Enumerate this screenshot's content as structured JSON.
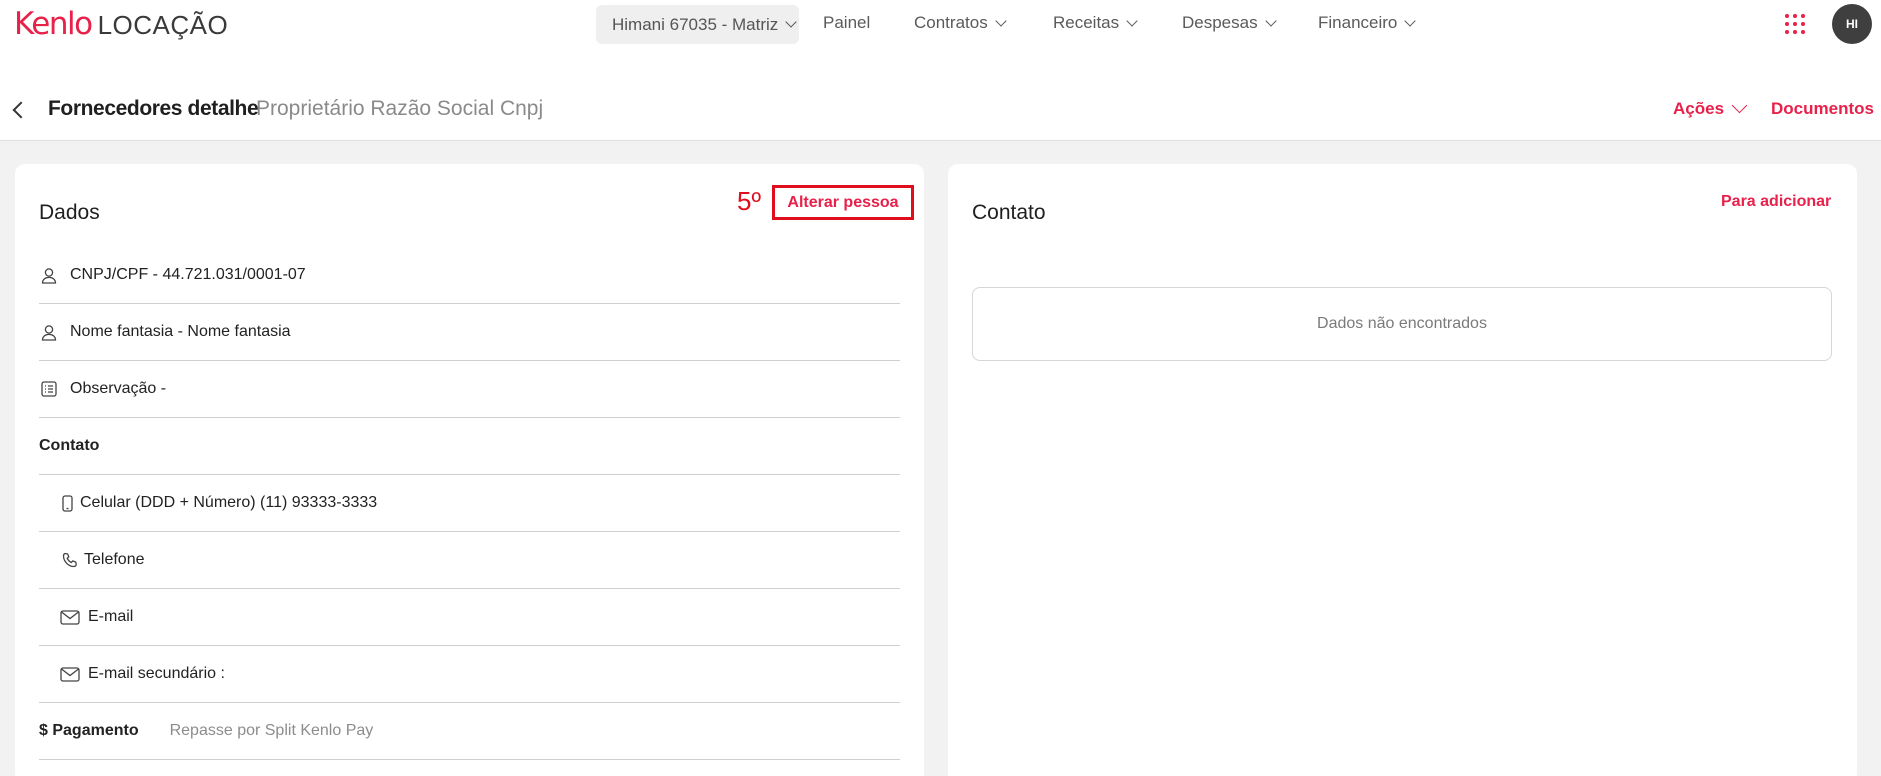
{
  "topbar": {
    "brand": "Kenlo",
    "product": "LOCAÇÃO",
    "selector": "Himani 67035 - Matriz",
    "nav": [
      {
        "label": "Painel"
      },
      {
        "label": "Contratos"
      },
      {
        "label": "Receitas"
      },
      {
        "label": "Despesas"
      },
      {
        "label": "Financeiro"
      }
    ],
    "avatar_initials": "HI",
    "apps_icon": "grid-dots-icon"
  },
  "header": {
    "title": "Fornecedores detalhe",
    "subtitle": "Proprietário Razão Social Cnpj",
    "acoes": "Ações",
    "documentos": "Documentos"
  },
  "dados": {
    "title": "Dados",
    "step_marker": "5º",
    "alterar": "Alterar pessoa",
    "rows": [
      {
        "icon": "user-icon",
        "text": "CNPJ/CPF - 44.721.031/0001-07"
      },
      {
        "icon": "user-icon",
        "text": "Nome fantasia - Nome fantasia"
      },
      {
        "icon": "note-icon",
        "text": "Observação -"
      }
    ],
    "contato_heading": "Contato",
    "contato_rows": [
      {
        "icon": "mobile-icon",
        "text": "Celular (DDD + Número) (11) 93333-3333"
      },
      {
        "icon": "phone-icon",
        "text": "Telefone"
      },
      {
        "icon": "mail-icon",
        "text": "E-mail"
      },
      {
        "icon": "mail-icon",
        "text": "E-mail secundário :"
      }
    ],
    "pagamento_label": "$ Pagamento",
    "pagamento_value": "Repasse por Split Kenlo Pay"
  },
  "contato_panel": {
    "title": "Contato",
    "add": "Para adicionar",
    "empty": "Dados não encontrados"
  },
  "colors": {
    "accent": "#e8214b",
    "annotation": "#e00d1f"
  }
}
